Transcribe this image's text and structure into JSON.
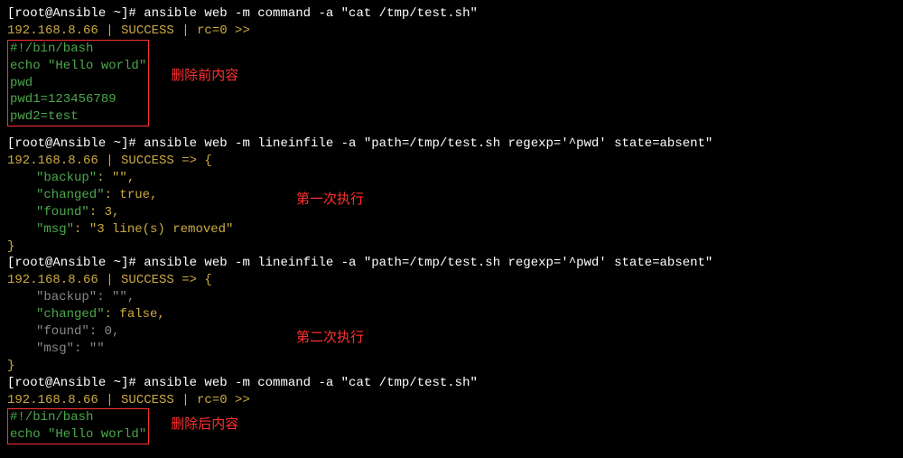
{
  "lines": {
    "cmd1": "[root@Ansible ~]# ansible web -m command -a \"cat /tmp/test.sh\"",
    "success1": "192.168.8.66 | SUCCESS | rc=0 >>",
    "file1_l1": "#!/bin/bash",
    "file1_l2": "echo \"Hello world\"",
    "file1_l3": "pwd",
    "file1_l4": "pwd1=123456789",
    "file1_l5": "pwd2=test",
    "annotation1": "删除前内容",
    "cmd2": "[root@Ansible ~]# ansible web -m lineinfile -a \"path=/tmp/test.sh regexp='^pwd' state=absent\"",
    "success2": "192.168.8.66 | SUCCESS => {",
    "run1_backup_k": "\"backup\"",
    "run1_backup_v": ": \"\", ",
    "run1_changed_k": "\"changed\"",
    "run1_changed_v": ": true, ",
    "run1_found_k": "\"found\"",
    "run1_found_v": ": 3, ",
    "run1_msg_k": "\"msg\"",
    "run1_msg_v": ": \"3 line(s) removed\"",
    "close_brace": "}",
    "annotation2": "第一次执行",
    "cmd3": "[root@Ansible ~]# ansible web -m lineinfile -a \"path=/tmp/test.sh regexp='^pwd' state=absent\"",
    "success3": "192.168.8.66 | SUCCESS => {",
    "run2_backup_k": "\"backup\"",
    "run2_backup_v": ": \"\", ",
    "run2_changed_k": "\"changed\"",
    "run2_changed_v": ": false, ",
    "run2_found_k": "\"found\"",
    "run2_found_v": ": 0, ",
    "run2_msg_k": "\"msg\"",
    "run2_msg_v": ": \"\"",
    "annotation3": "第二次执行",
    "cmd4": "[root@Ansible ~]# ansible web -m command -a \"cat /tmp/test.sh\"",
    "success4": "192.168.8.66 | SUCCESS | rc=0 >>",
    "file2_l1": "#!/bin/bash",
    "file2_l2": "echo \"Hello world\"",
    "annotation4": "删除后内容"
  }
}
